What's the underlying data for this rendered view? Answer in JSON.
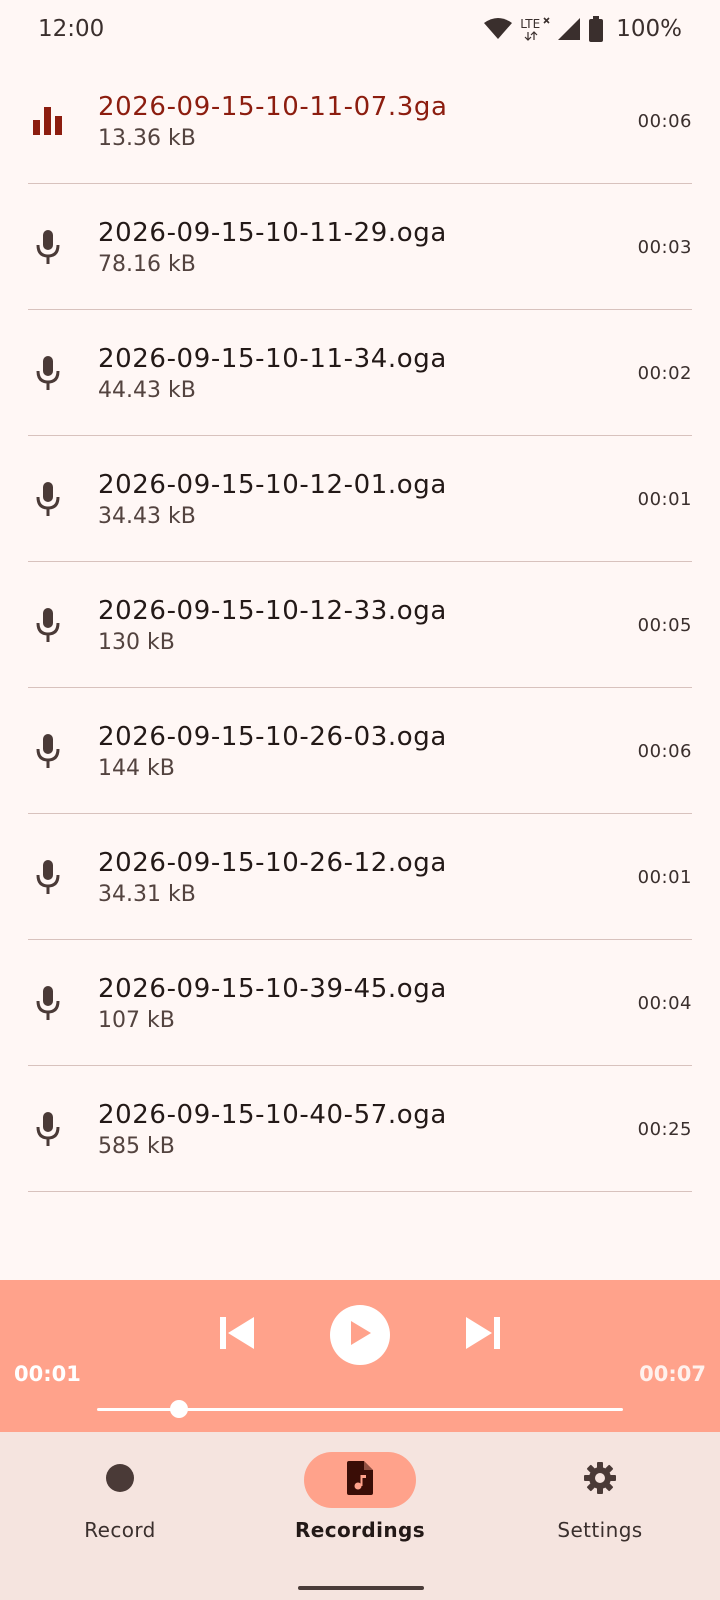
{
  "status_bar": {
    "time": "12:00",
    "network": "LTE",
    "battery": "100%",
    "icons": [
      "wifi-icon",
      "lte-icon",
      "signal-icon",
      "battery-icon"
    ]
  },
  "recordings": [
    {
      "name": "2026-09-15-10-11-07.3ga",
      "size": "13.36 kB",
      "duration": "00:06",
      "icon": "equalizer-icon",
      "active": true
    },
    {
      "name": "2026-09-15-10-11-29.oga",
      "size": "78.16 kB",
      "duration": "00:03",
      "icon": "mic-icon",
      "active": false
    },
    {
      "name": "2026-09-15-10-11-34.oga",
      "size": "44.43 kB",
      "duration": "00:02",
      "icon": "mic-icon",
      "active": false
    },
    {
      "name": "2026-09-15-10-12-01.oga",
      "size": "34.43 kB",
      "duration": "00:01",
      "icon": "mic-icon",
      "active": false
    },
    {
      "name": "2026-09-15-10-12-33.oga",
      "size": "130 kB",
      "duration": "00:05",
      "icon": "mic-icon",
      "active": false
    },
    {
      "name": "2026-09-15-10-26-03.oga",
      "size": "144 kB",
      "duration": "00:06",
      "icon": "mic-icon",
      "active": false
    },
    {
      "name": "2026-09-15-10-26-12.oga",
      "size": "34.31 kB",
      "duration": "00:01",
      "icon": "mic-icon",
      "active": false
    },
    {
      "name": "2026-09-15-10-39-45.oga",
      "size": "107 kB",
      "duration": "00:04",
      "icon": "mic-icon",
      "active": false
    },
    {
      "name": "2026-09-15-10-40-57.oga",
      "size": "585 kB",
      "duration": "00:25",
      "icon": "mic-icon",
      "active": false
    }
  ],
  "player": {
    "current_time": "00:01",
    "total_time": "00:07",
    "progress": 0.155,
    "icons": [
      "skip-previous-icon",
      "play-icon",
      "skip-next-icon"
    ]
  },
  "nav": {
    "items": [
      {
        "label": "Record",
        "icon": "record-dot-icon",
        "active": false
      },
      {
        "label": "Recordings",
        "icon": "audio-file-icon",
        "active": true
      },
      {
        "label": "Settings",
        "icon": "gear-icon",
        "active": false
      }
    ]
  },
  "colors": {
    "background": "#fff7f5",
    "accent": "#ffa28b",
    "active_text": "#8c1d0f",
    "nav_background": "#f5e4df",
    "divider": "#d8c2bd"
  }
}
